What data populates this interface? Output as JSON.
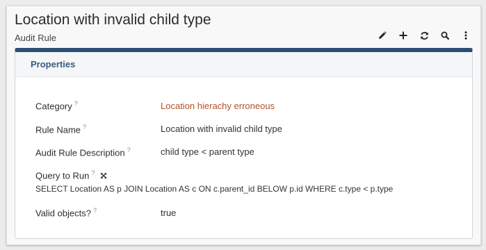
{
  "header": {
    "title": "Location with invalid child type",
    "subtitle": "Audit Rule"
  },
  "toolbar": {
    "buttons": [
      {
        "name": "edit",
        "icon": "pencil-icon"
      },
      {
        "name": "add",
        "icon": "plus-icon"
      },
      {
        "name": "refresh",
        "icon": "refresh-icon"
      },
      {
        "name": "search",
        "icon": "search-icon"
      },
      {
        "name": "more",
        "icon": "more-vertical-icon"
      }
    ]
  },
  "panel": {
    "title": "Properties",
    "accent_color": "#2d4e73"
  },
  "fields": {
    "category": {
      "label": "Category",
      "help": "?",
      "value": "Location hierachy erroneous",
      "value_color": "#b0532a"
    },
    "rule_name": {
      "label": "Rule Name",
      "help": "?",
      "value": "Location with invalid child type"
    },
    "description": {
      "label": "Audit Rule Description",
      "help": "?",
      "value": "child type < parent type"
    },
    "query": {
      "label": "Query to Run",
      "help": "?",
      "value": "SELECT Location AS p JOIN Location AS c ON c.parent_id BELOW p.id WHERE c.type < p.type"
    },
    "valid_objects": {
      "label": "Valid objects?",
      "help": "?",
      "value": "true"
    }
  }
}
